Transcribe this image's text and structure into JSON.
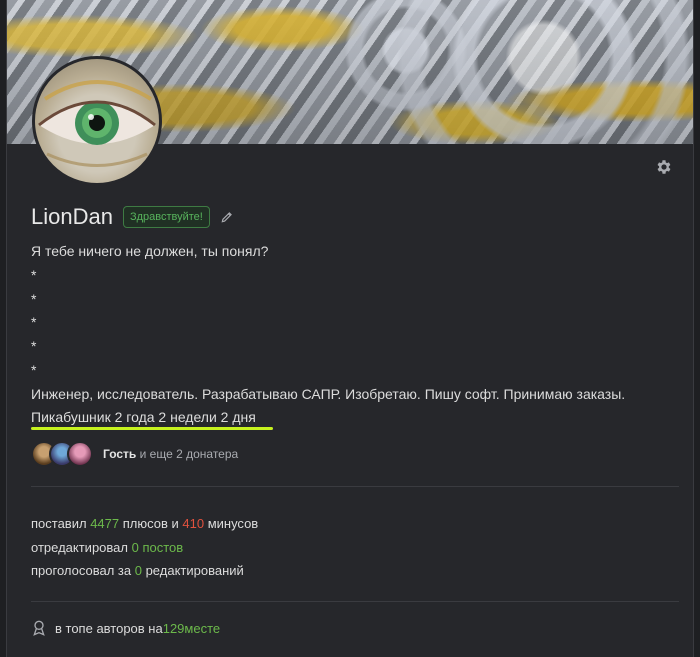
{
  "profile": {
    "username": "LionDan",
    "greeting_badge": "Здравствуйте!",
    "bio_lines": [
      "Я тебе ничего не должен, ты понял?",
      "*",
      "*",
      "*",
      "*",
      "*",
      "Инженер, исследователь. Разрабатываю САПР. Изобретаю. Пишу софт. Принимаю заказы."
    ],
    "tenure": "Пикабушник 2 года 2 недели 2 дня"
  },
  "donors": {
    "first_name": "Гость",
    "rest_text": " и еще 2 донатера"
  },
  "stats": {
    "line1": {
      "prefix": "поставил ",
      "pluses": "4477",
      "mid": " плюсов и ",
      "minuses": "410",
      "suffix": " минусов"
    },
    "line2": {
      "prefix": "отредактировал ",
      "value": "0",
      "suffix": " постов"
    },
    "line3": {
      "prefix": "проголосовал за ",
      "value": "0",
      "suffix": " редактирований"
    }
  },
  "rating": {
    "prefix": "в топе авторов на ",
    "value": "129",
    "suffix": " месте"
  },
  "colors": {
    "accent_green": "#6cb94b",
    "minus_red": "#e0513e",
    "highlight_underline": "#c6f21e"
  },
  "icons": {
    "settings": "gear-icon",
    "edit": "pencil-icon",
    "rating": "award-icon"
  }
}
